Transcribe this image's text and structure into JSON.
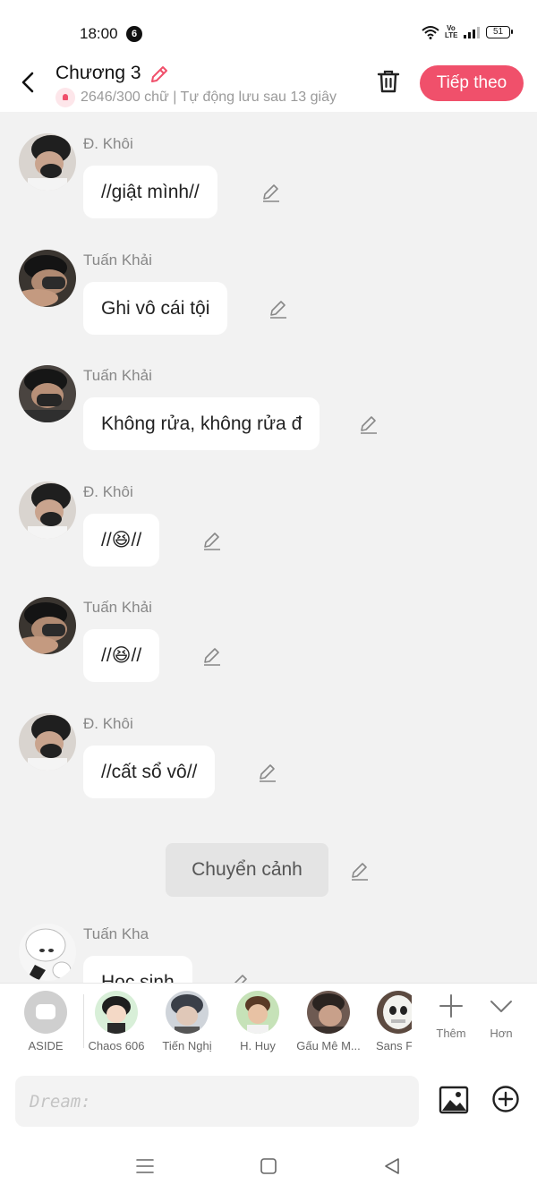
{
  "status_bar": {
    "time": "18:00",
    "notification_count": "6",
    "network_label": "Vo LTE",
    "battery": "51"
  },
  "header": {
    "title": "Chương 3",
    "subtitle": "2646/300 chữ | Tự động lưu sau 13 giây",
    "next_label": "Tiếp theo"
  },
  "messages": [
    {
      "sender": "Đ. Khôi",
      "text": "//giật mình//"
    },
    {
      "sender": "Tuấn Khải",
      "text": "Ghi vô cái tội"
    },
    {
      "sender": "Tuấn Khải",
      "text": "Không rửa, không rửa đ"
    },
    {
      "sender": "Đ. Khôi",
      "text": "//😆//"
    },
    {
      "sender": "Tuấn Khải",
      "text": "//😆//"
    },
    {
      "sender": "Đ. Khôi",
      "text": "//cất sổ vô//"
    },
    {
      "sender": "Tuấn Kha",
      "text": "Học sinh"
    }
  ],
  "scene_change_label": "Chuyển cảnh",
  "characters": [
    {
      "name": "ASIDE"
    },
    {
      "name": "Chaos 606"
    },
    {
      "name": "Tiến Nghị"
    },
    {
      "name": "H. Huy"
    },
    {
      "name": "Gấu Mê M..."
    },
    {
      "name": "Sans F"
    }
  ],
  "tools": {
    "add_label": "Thêm",
    "more_label": "Hơn"
  },
  "input": {
    "placeholder": "Dream:"
  },
  "colors": {
    "accent": "#f0506b",
    "background": "#f2f2f2"
  }
}
